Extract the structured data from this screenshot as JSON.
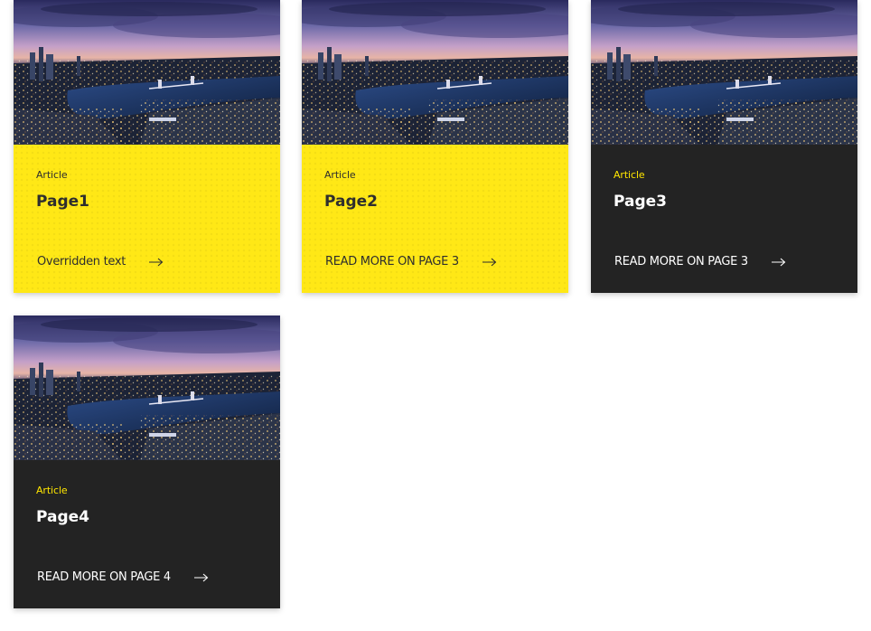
{
  "colors": {
    "yellow": "#ffe816",
    "dark": "#232323",
    "accent_yellow": "#ffe600",
    "text_dark": "#2e2e2e",
    "text_light": "#ffffff"
  },
  "cards": [
    {
      "theme": "yellow",
      "image": "city-skyline-at-night",
      "type_label": "Article",
      "title": "Page1",
      "cta_label": "Overridden text",
      "cta_icon": "arrow-right-icon"
    },
    {
      "theme": "yellow",
      "image": "city-skyline-at-night",
      "type_label": "Article",
      "title": "Page2",
      "cta_label": "READ MORE ON PAGE 3",
      "cta_icon": "arrow-right-icon"
    },
    {
      "theme": "dark",
      "image": "city-skyline-at-night",
      "type_label": "Article",
      "title": "Page3",
      "cta_label": "READ MORE ON PAGE 3",
      "cta_icon": "arrow-right-icon"
    },
    {
      "theme": "dark",
      "image": "city-skyline-at-night",
      "type_label": "Article",
      "title": "Page4",
      "cta_label": "READ MORE ON PAGE 4",
      "cta_icon": "arrow-right-icon"
    }
  ]
}
